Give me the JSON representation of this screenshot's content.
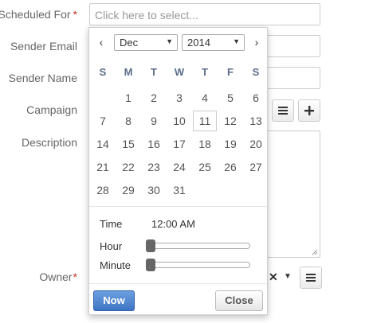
{
  "form": {
    "scheduled_for": {
      "label": "Scheduled For",
      "required_mark": "*",
      "placeholder": "Click here to select..."
    },
    "sender_email": {
      "label": "Sender Email"
    },
    "sender_name": {
      "label": "Sender Name"
    },
    "campaign": {
      "label": "Campaign",
      "list_icon": "list-icon",
      "add_icon": "plus-icon"
    },
    "description": {
      "label": "Description"
    },
    "owner": {
      "label": "Owner",
      "required_mark": "*",
      "clear_icon": "x-icon",
      "dropdown_icon": "caret-down-icon",
      "list_icon": "list-icon"
    }
  },
  "datepicker": {
    "prev": "‹",
    "next": "›",
    "month": "Dec",
    "year": "2014",
    "weekdays": [
      "S",
      "M",
      "T",
      "W",
      "T",
      "F",
      "S"
    ],
    "weeks": [
      [
        "",
        "1",
        "2",
        "3",
        "4",
        "5",
        "6"
      ],
      [
        "7",
        "8",
        "9",
        "10",
        "11",
        "12",
        "13"
      ],
      [
        "14",
        "15",
        "16",
        "17",
        "18",
        "19",
        "20"
      ],
      [
        "21",
        "22",
        "23",
        "24",
        "25",
        "26",
        "27"
      ],
      [
        "28",
        "29",
        "30",
        "31",
        "",
        "",
        ""
      ]
    ],
    "today": "11",
    "time_label": "Time",
    "time_value": "12:00 AM",
    "hour_label": "Hour",
    "minute_label": "Minute",
    "hour_value": 0,
    "minute_value": 0,
    "now_label": "Now",
    "close_label": "Close"
  },
  "colors": {
    "required": "#c9302c",
    "now_button": "#3f74c4",
    "weekday": "#5a6d8a"
  }
}
